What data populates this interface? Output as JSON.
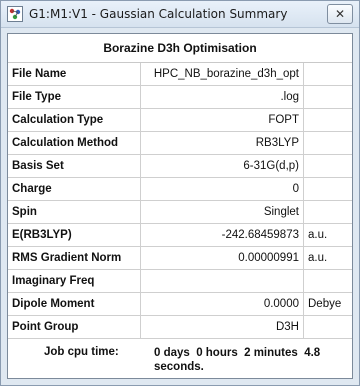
{
  "window": {
    "title": "G1:M1:V1 - Gaussian Calculation Summary",
    "close_glyph": "✕"
  },
  "summary": {
    "header": "Borazine D3h Optimisation",
    "rows": [
      {
        "label": "File Name",
        "value": "HPC_NB_borazine_d3h_opt",
        "unit": ""
      },
      {
        "label": "File Type",
        "value": ".log",
        "unit": ""
      },
      {
        "label": "Calculation Type",
        "value": "FOPT",
        "unit": ""
      },
      {
        "label": "Calculation Method",
        "value": "RB3LYP",
        "unit": ""
      },
      {
        "label": "Basis Set",
        "value": "6-31G(d,p)",
        "unit": ""
      },
      {
        "label": "Charge",
        "value": "0",
        "unit": ""
      },
      {
        "label": "Spin",
        "value": "Singlet",
        "unit": ""
      },
      {
        "label": "E(RB3LYP)",
        "value": "-242.68459873",
        "unit": "a.u."
      },
      {
        "label": "RMS Gradient Norm",
        "value": "0.00000991",
        "unit": "a.u."
      },
      {
        "label": "Imaginary Freq",
        "value": "",
        "unit": ""
      },
      {
        "label": "Dipole Moment",
        "value": "0.0000",
        "unit": "Debye"
      },
      {
        "label": "Point Group",
        "value": "D3H",
        "unit": ""
      }
    ],
    "footer": {
      "label": "Job cpu time:",
      "value": "0 days  0 hours  2 minutes  4.8 seconds."
    }
  }
}
